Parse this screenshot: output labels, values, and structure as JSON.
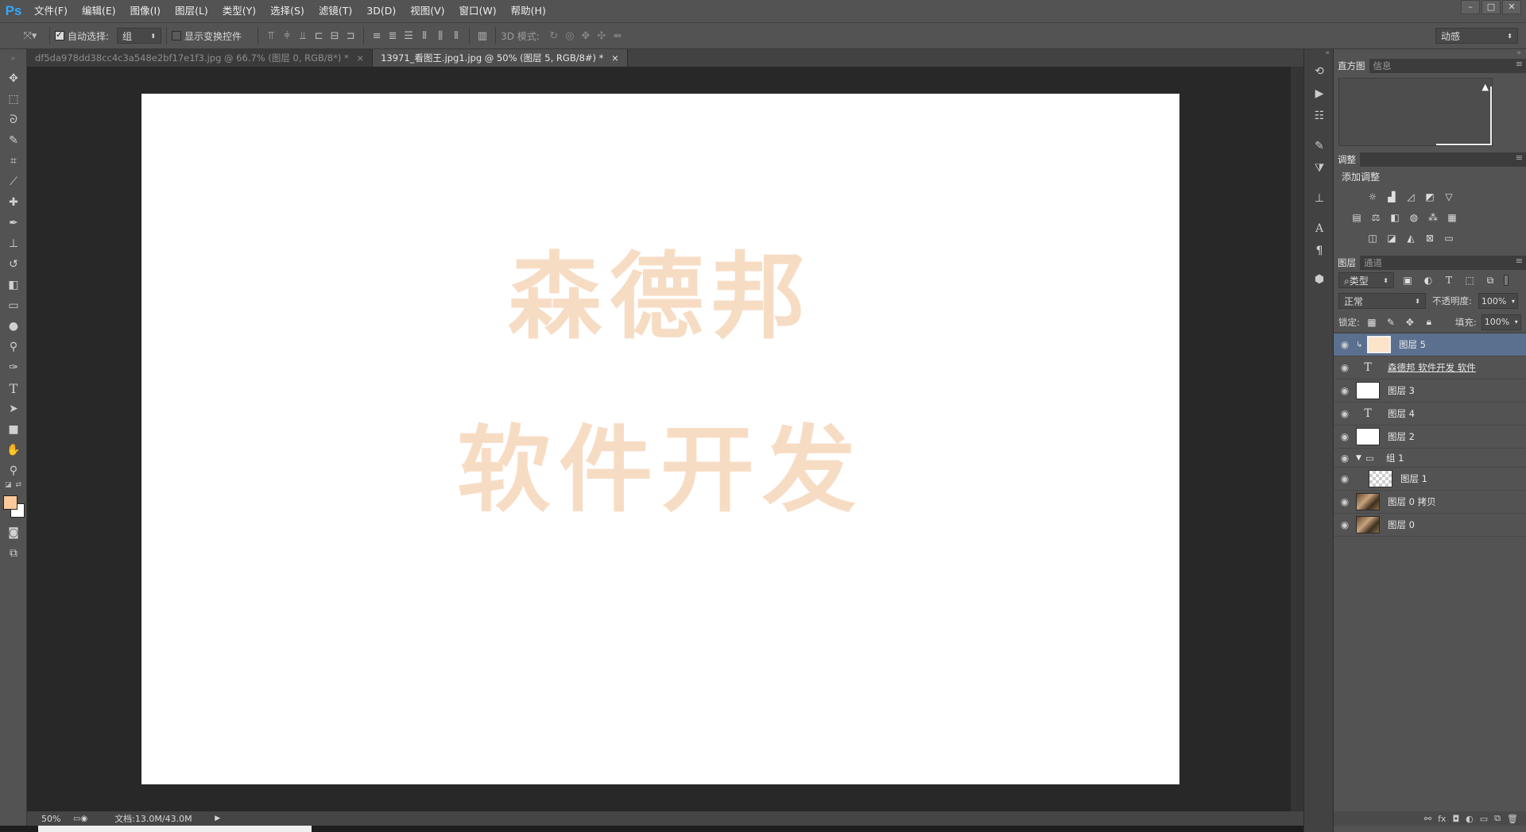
{
  "app": {
    "logo": "Ps"
  },
  "menu": [
    "文件(F)",
    "编辑(E)",
    "图像(I)",
    "图层(L)",
    "类型(Y)",
    "选择(S)",
    "滤镜(T)",
    "3D(D)",
    "视图(V)",
    "窗口(W)",
    "帮助(H)"
  ],
  "options": {
    "auto_select_label": "自动选择:",
    "auto_select_value": "组",
    "show_transform_label": "显示变换控件",
    "mode3d_label": "3D 模式:",
    "workspace_value": "动感"
  },
  "tabs": [
    {
      "label": "df5da978dd38cc4c3a548e2bf17e1f3.jpg @ 66.7% (图层 0, RGB/8*) *",
      "close": "×"
    },
    {
      "label": "13971_看图王.jpg1.jpg @ 50% (图层 5, RGB/8#) *",
      "close": "×"
    }
  ],
  "canvas": {
    "line1": "森德邦",
    "line2": "软件开发"
  },
  "status": {
    "zoom": "50%",
    "doc": "文档:13.0M/43.0M"
  },
  "panels": {
    "histogram_tab": "直方图",
    "info_tab": "信息",
    "adjust_tab": "调整",
    "add_adjust_label": "添加调整",
    "layers_tab": "图层",
    "channels_tab": "通道",
    "filter_kind": "类型",
    "blend_mode": "正常",
    "opacity_label": "不透明度:",
    "opacity_value": "100%",
    "lock_label": "锁定:",
    "fill_label": "填充:",
    "fill_value": "100%"
  },
  "layers": [
    {
      "name": "图层 5",
      "kind": "image",
      "thumb_color": "#fde3c8",
      "selected": true,
      "indent": true
    },
    {
      "name": "森德邦 软件开发  软件",
      "kind": "text"
    },
    {
      "name": "图层 3",
      "kind": "image",
      "thumb_color": "#ffffff"
    },
    {
      "name": "图层 4",
      "kind": "text"
    },
    {
      "name": "图层 2",
      "kind": "image",
      "thumb_color": "#ffffff"
    },
    {
      "name": "组 1",
      "kind": "group"
    },
    {
      "name": "图层 1",
      "kind": "image",
      "thumb_color": "checker",
      "nested": true
    },
    {
      "name": "图层 0 拷贝",
      "kind": "image",
      "thumb_color": "photo"
    },
    {
      "name": "图层 0",
      "kind": "image",
      "thumb_color": "photo"
    }
  ],
  "colors": {
    "foreground": "#fbc99a",
    "background": "#ffffff",
    "watermark": "#f7dcc4",
    "accent": "#31a8ff"
  }
}
